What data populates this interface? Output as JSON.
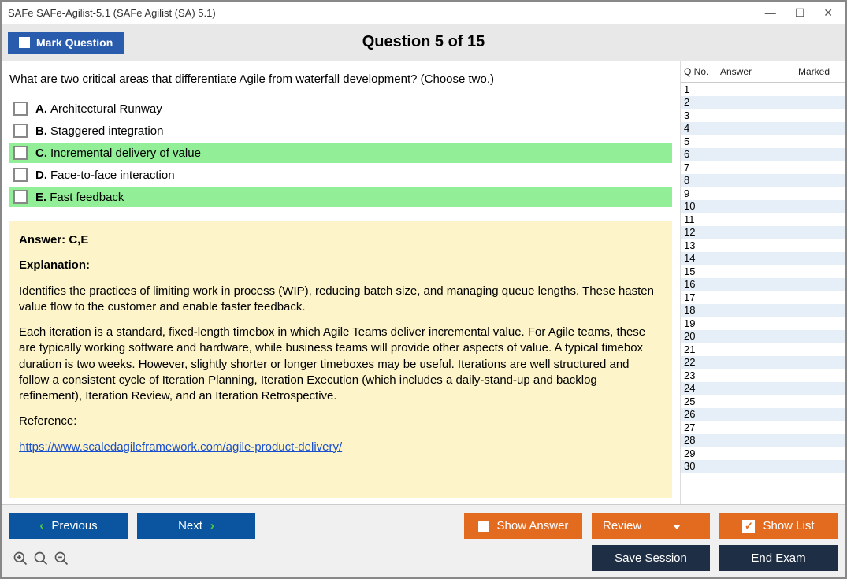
{
  "window": {
    "title": "SAFe SAFe-Agilist-5.1 (SAFe Agilist (SA) 5.1)"
  },
  "header": {
    "mark_label": "Mark Question",
    "counter": "Question 5 of 15"
  },
  "question": {
    "text": "What are two critical areas that differentiate Agile from waterfall development? (Choose two.)",
    "options": [
      {
        "letter": "A.",
        "text": "Architectural Runway",
        "highlight": false
      },
      {
        "letter": "B.",
        "text": "Staggered integration",
        "highlight": false
      },
      {
        "letter": "C.",
        "text": "Incremental delivery of value",
        "highlight": true
      },
      {
        "letter": "D.",
        "text": "Face-to-face interaction",
        "highlight": false
      },
      {
        "letter": "E.",
        "text": "Fast feedback",
        "highlight": true
      }
    ]
  },
  "answer": {
    "line": "Answer: C,E",
    "expl_label": "Explanation:",
    "p1": "Identifies the practices of limiting work in process (WIP), reducing batch size, and managing queue lengths. These hasten value flow to the customer and enable faster feedback.",
    "p2": "Each iteration is a standard, fixed-length timebox in which Agile Teams deliver incremental value. For Agile teams, these are typically working software and hardware, while business teams will provide other aspects of value. A typical timebox duration is two weeks. However, slightly shorter or longer timeboxes may be useful. Iterations are well structured and follow a consistent cycle of Iteration Planning, Iteration Execution (which includes a daily-stand-up and backlog refinement), Iteration Review, and an Iteration Retrospective.",
    "ref_label": "Reference:",
    "ref_url": "https://www.scaledagileframework.com/agile-product-delivery/"
  },
  "listpanel": {
    "h_qno": "Q No.",
    "h_answer": "Answer",
    "h_marked": "Marked",
    "rows": [
      "1",
      "2",
      "3",
      "4",
      "5",
      "6",
      "7",
      "8",
      "9",
      "10",
      "11",
      "12",
      "13",
      "14",
      "15",
      "16",
      "17",
      "18",
      "19",
      "20",
      "21",
      "22",
      "23",
      "24",
      "25",
      "26",
      "27",
      "28",
      "29",
      "30"
    ]
  },
  "footer": {
    "previous": "Previous",
    "next": "Next",
    "show_answer": "Show Answer",
    "review": "Review",
    "show_list": "Show List",
    "save_session": "Save Session",
    "end_exam": "End Exam"
  }
}
